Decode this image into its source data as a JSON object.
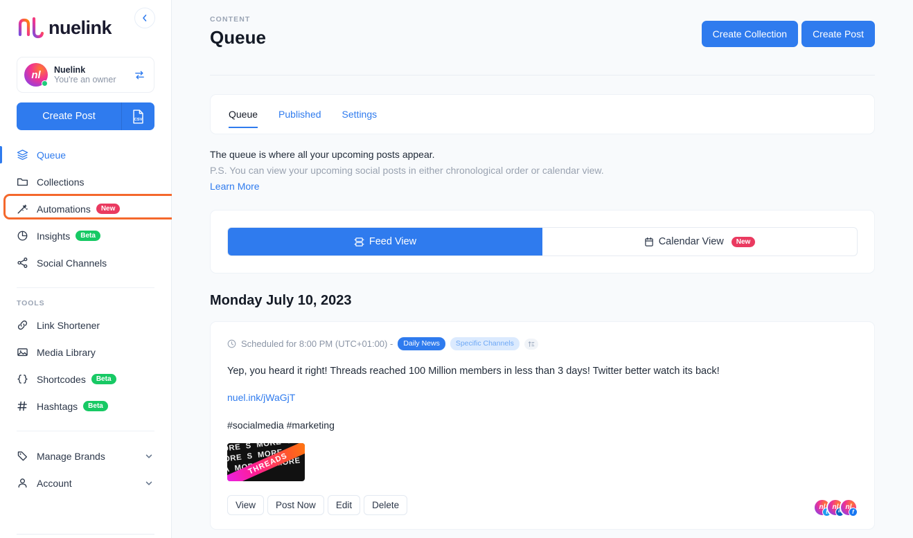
{
  "sidebar": {
    "brand": "nuelink",
    "collapse_icon": "chevron-left-icon",
    "profile": {
      "name": "Nuelink",
      "role": "You're an owner",
      "switch_icon": "switch-accounts-icon",
      "initials": "nl"
    },
    "create_post": {
      "label": "Create Post",
      "csv_icon": "csv-file-icon"
    },
    "nav": [
      {
        "label": "Queue",
        "icon": "layers-icon",
        "active": true,
        "badge": null
      },
      {
        "label": "Collections",
        "icon": "folder-icon",
        "active": false,
        "badge": null
      },
      {
        "label": "Automations",
        "icon": "magic-wand-icon",
        "active": false,
        "badge": "New",
        "badge_type": "new",
        "highlighted": true
      },
      {
        "label": "Insights",
        "icon": "pie-chart-icon",
        "active": false,
        "badge": "Beta",
        "badge_type": "beta"
      },
      {
        "label": "Social Channels",
        "icon": "share-nodes-icon",
        "active": false,
        "badge": null
      }
    ],
    "tools_label": "TOOLS",
    "tools": [
      {
        "label": "Link Shortener",
        "icon": "link-icon",
        "badge": null
      },
      {
        "label": "Media Library",
        "icon": "image-icon",
        "badge": null
      },
      {
        "label": "Shortcodes",
        "icon": "braces-icon",
        "badge": "Beta",
        "badge_type": "beta"
      },
      {
        "label": "Hashtags",
        "icon": "hash-icon",
        "badge": "Beta",
        "badge_type": "beta"
      }
    ],
    "footer_nav": [
      {
        "label": "Manage Brands",
        "icon": "tag-icon",
        "chevron": "chevron-down-icon"
      },
      {
        "label": "Account",
        "icon": "user-icon",
        "chevron": "chevron-down-icon"
      }
    ]
  },
  "header": {
    "eyebrow": "CONTENT",
    "title": "Queue",
    "create_collection_label": "Create Collection",
    "create_post_label": "Create Post"
  },
  "tabs": [
    {
      "label": "Queue",
      "active": true
    },
    {
      "label": "Published",
      "active": false
    },
    {
      "label": "Settings",
      "active": false
    }
  ],
  "description": {
    "line1": "The queue is where all your upcoming posts appear.",
    "line2": "P.S. You can view your upcoming social posts in either chronological order or calendar view.",
    "learn_more": "Learn More"
  },
  "view_toggle": {
    "feed": {
      "label": "Feed View",
      "icon": "feed-list-icon",
      "active": true
    },
    "calendar": {
      "label": "Calendar View",
      "icon": "calendar-icon",
      "active": false,
      "badge": "New"
    }
  },
  "day_group": {
    "date_title": "Monday July 10, 2023",
    "post": {
      "clock_icon": "clock-icon",
      "schedule_text": "Scheduled for 8:00 PM (UTC+01:00) -",
      "chips": [
        {
          "label": "Daily News",
          "style": "daily"
        },
        {
          "label": "Specific Channels",
          "style": "specific"
        }
      ],
      "sort_icon": "sort-icon",
      "body": "Yep, you heard it right! Threads reached 100 Million members in less than 3 days! Twitter better watch its back!",
      "link": "nuel.ink/jWaGjT",
      "tags": "#socialmedia #marketing",
      "thumbnail": {
        "alt": "threads-poster-thumbnail",
        "band_text": "THREADS",
        "tile_text": "MORE S MORE SA MORE S MORE MORE SA MORE S MORE MO"
      },
      "actions": [
        "View",
        "Post Now",
        "Edit",
        "Delete"
      ],
      "channels": [
        {
          "name": "twitter-channel",
          "badge_icon": "twitter-icon",
          "badge_color": "#1d9bf0",
          "glyph": "t"
        },
        {
          "name": "linkedin-channel",
          "badge_icon": "linkedin-icon",
          "badge_color": "#0a66c2",
          "glyph": "in"
        },
        {
          "name": "facebook-channel",
          "badge_icon": "facebook-icon",
          "badge_color": "#1877f2",
          "glyph": "f"
        }
      ]
    }
  },
  "colors": {
    "accent": "#2f7bee",
    "highlight": "#f4682c",
    "badge_new": "#ea3a60",
    "badge_beta": "#17c964",
    "page_bg": "#f8fafc"
  }
}
